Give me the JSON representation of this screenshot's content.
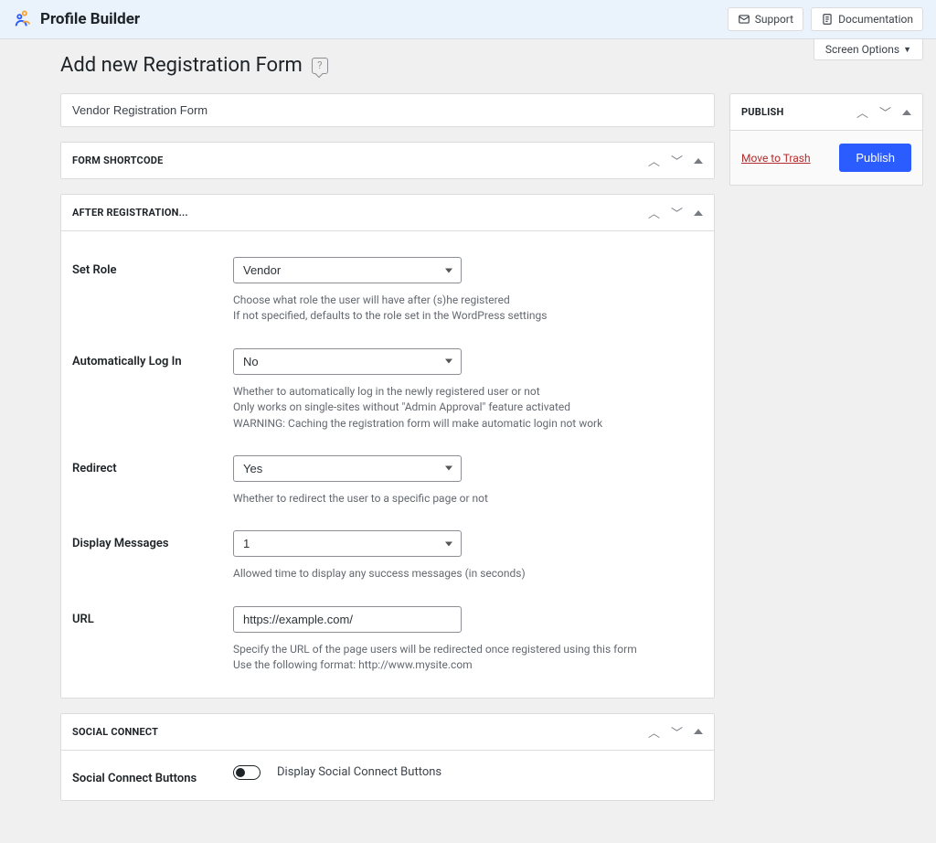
{
  "brand": {
    "name": "Profile Builder"
  },
  "topbar": {
    "support": "Support",
    "documentation": "Documentation"
  },
  "screen_options": "Screen Options",
  "page": {
    "title": "Add new Registration Form"
  },
  "title_input": {
    "value": "Vendor Registration Form"
  },
  "sections": {
    "form_shortcode": {
      "title": "FORM SHORTCODE"
    },
    "after_registration": {
      "title": "AFTER REGISTRATION..."
    },
    "social_connect": {
      "title": "SOCIAL CONNECT"
    }
  },
  "fields": {
    "set_role": {
      "label": "Set Role",
      "value": "Vendor",
      "desc1": "Choose what role the user will have after (s)he registered",
      "desc2": "If not specified, defaults to the role set in the WordPress settings"
    },
    "auto_login": {
      "label": "Automatically Log In",
      "value": "No",
      "desc1": "Whether to automatically log in the newly registered user or not",
      "desc2": "Only works on single-sites without \"Admin Approval\" feature activated",
      "desc3": "WARNING: Caching the registration form will make automatic login not work"
    },
    "redirect": {
      "label": "Redirect",
      "value": "Yes",
      "desc1": "Whether to redirect the user to a specific page or not"
    },
    "display_messages": {
      "label": "Display Messages",
      "value": "1",
      "desc1": "Allowed time to display any success messages (in seconds)"
    },
    "url": {
      "label": "URL",
      "value": "https://example.com/",
      "desc1": "Specify the URL of the page users will be redirected once registered using this form",
      "desc2": "Use the following format: http://www.mysite.com"
    },
    "social_buttons": {
      "label": "Social Connect Buttons",
      "text": "Display Social Connect Buttons"
    }
  },
  "publish": {
    "title": "PUBLISH",
    "trash": "Move to Trash",
    "button": "Publish"
  }
}
